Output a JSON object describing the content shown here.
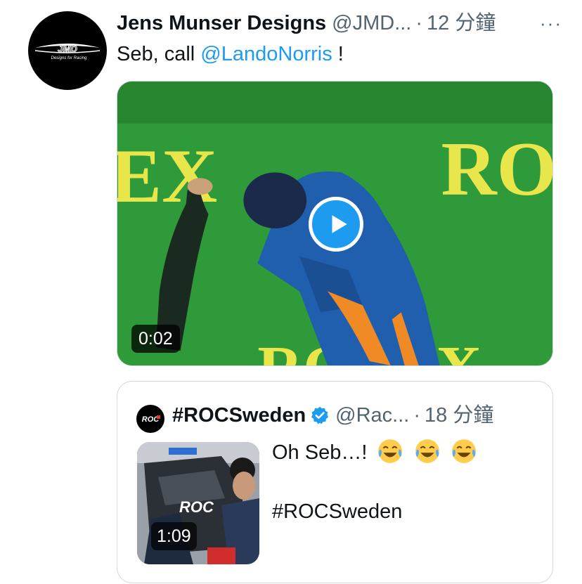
{
  "tweet": {
    "display_name": "Jens Munser Designs",
    "handle": "@JMD...",
    "separator": "·",
    "time": "12 分鐘",
    "more": "···",
    "text_prefix": "Seb, call ",
    "mention": "@LandoNorris",
    "text_suffix": " !",
    "video_duration": "0:02"
  },
  "quoted": {
    "display_name": "#ROCSweden",
    "handle": "@Rac...",
    "separator": "·",
    "time": "18 分鐘",
    "text_line1": "Oh Seb…!",
    "text_line2": "#ROCSweden",
    "video_duration": "1:09"
  },
  "colors": {
    "accent": "#1d9bf0",
    "secondary_text": "#536471",
    "border": "#cfd9de"
  }
}
